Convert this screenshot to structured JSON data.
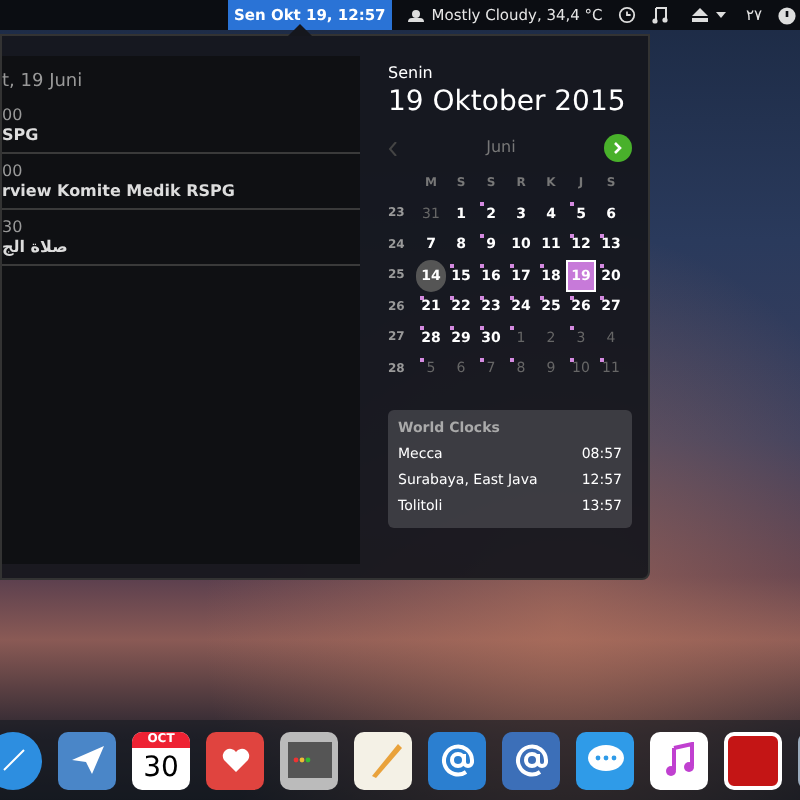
{
  "top_bar": {
    "clock": "Sen Okt 19, 12:57",
    "clock_selected": true,
    "weather": "Mostly Cloudy, 34,4 °C",
    "keyboard_layout": "٢٧"
  },
  "events": {
    "header": "t, 19 Juni",
    "items": [
      {
        "time": "00",
        "title": "SPG"
      },
      {
        "time": "00",
        "title": "rview Komite Medik RSPG"
      },
      {
        "time": "30",
        "title": "صلاة الج"
      }
    ]
  },
  "date": {
    "weekday": "Senin",
    "full": "19 Oktober 2015"
  },
  "calendar": {
    "month": "Juni",
    "day_headers": [
      "M",
      "S",
      "S",
      "R",
      "K",
      "J",
      "S"
    ],
    "weeks": [
      {
        "number": "23",
        "days": [
          {
            "label": "31",
            "muted": true,
            "event": false,
            "selected": false,
            "today": false
          },
          {
            "label": "1",
            "muted": false,
            "event": false,
            "selected": false,
            "today": false
          },
          {
            "label": "2",
            "muted": false,
            "event": true,
            "selected": false,
            "today": false
          },
          {
            "label": "3",
            "muted": false,
            "event": false,
            "selected": false,
            "today": false
          },
          {
            "label": "4",
            "muted": false,
            "event": false,
            "selected": false,
            "today": false
          },
          {
            "label": "5",
            "muted": false,
            "event": true,
            "selected": false,
            "today": false
          },
          {
            "label": "6",
            "muted": false,
            "event": false,
            "selected": false,
            "today": false
          }
        ]
      },
      {
        "number": "24",
        "days": [
          {
            "label": "7",
            "muted": false,
            "event": false,
            "selected": false,
            "today": false
          },
          {
            "label": "8",
            "muted": false,
            "event": false,
            "selected": false,
            "today": false
          },
          {
            "label": "9",
            "muted": false,
            "event": true,
            "selected": false,
            "today": false
          },
          {
            "label": "10",
            "muted": false,
            "event": false,
            "selected": false,
            "today": false
          },
          {
            "label": "11",
            "muted": false,
            "event": false,
            "selected": false,
            "today": false
          },
          {
            "label": "12",
            "muted": false,
            "event": true,
            "selected": false,
            "today": false
          },
          {
            "label": "13",
            "muted": false,
            "event": true,
            "selected": false,
            "today": false
          }
        ]
      },
      {
        "number": "25",
        "days": [
          {
            "label": "14",
            "muted": false,
            "event": false,
            "selected": false,
            "today": true
          },
          {
            "label": "15",
            "muted": false,
            "event": true,
            "selected": false,
            "today": false
          },
          {
            "label": "16",
            "muted": false,
            "event": true,
            "selected": false,
            "today": false
          },
          {
            "label": "17",
            "muted": false,
            "event": true,
            "selected": false,
            "today": false
          },
          {
            "label": "18",
            "muted": false,
            "event": true,
            "selected": false,
            "today": false
          },
          {
            "label": "19",
            "muted": false,
            "event": false,
            "selected": true,
            "today": false
          },
          {
            "label": "20",
            "muted": false,
            "event": true,
            "selected": false,
            "today": false
          }
        ]
      },
      {
        "number": "26",
        "days": [
          {
            "label": "21",
            "muted": false,
            "event": true,
            "selected": false,
            "today": false
          },
          {
            "label": "22",
            "muted": false,
            "event": true,
            "selected": false,
            "today": false
          },
          {
            "label": "23",
            "muted": false,
            "event": true,
            "selected": false,
            "today": false
          },
          {
            "label": "24",
            "muted": false,
            "event": true,
            "selected": false,
            "today": false
          },
          {
            "label": "25",
            "muted": false,
            "event": true,
            "selected": false,
            "today": false
          },
          {
            "label": "26",
            "muted": false,
            "event": true,
            "selected": false,
            "today": false
          },
          {
            "label": "27",
            "muted": false,
            "event": true,
            "selected": false,
            "today": false
          }
        ]
      },
      {
        "number": "27",
        "days": [
          {
            "label": "28",
            "muted": false,
            "event": true,
            "selected": false,
            "today": false
          },
          {
            "label": "29",
            "muted": false,
            "event": true,
            "selected": false,
            "today": false
          },
          {
            "label": "30",
            "muted": false,
            "event": true,
            "selected": false,
            "today": false
          },
          {
            "label": "1",
            "muted": true,
            "event": true,
            "selected": false,
            "today": false
          },
          {
            "label": "2",
            "muted": true,
            "event": false,
            "selected": false,
            "today": false
          },
          {
            "label": "3",
            "muted": true,
            "event": true,
            "selected": false,
            "today": false
          },
          {
            "label": "4",
            "muted": true,
            "event": false,
            "selected": false,
            "today": false
          }
        ]
      },
      {
        "number": "28",
        "days": [
          {
            "label": "5",
            "muted": true,
            "event": true,
            "selected": false,
            "today": false
          },
          {
            "label": "6",
            "muted": true,
            "event": false,
            "selected": false,
            "today": false
          },
          {
            "label": "7",
            "muted": true,
            "event": true,
            "selected": false,
            "today": false
          },
          {
            "label": "8",
            "muted": true,
            "event": true,
            "selected": false,
            "today": false
          },
          {
            "label": "9",
            "muted": true,
            "event": false,
            "selected": false,
            "today": false
          },
          {
            "label": "10",
            "muted": true,
            "event": true,
            "selected": false,
            "today": false
          },
          {
            "label": "11",
            "muted": true,
            "event": true,
            "selected": false,
            "today": false
          }
        ]
      }
    ]
  },
  "world_clocks": {
    "title": "World Clocks",
    "items": [
      {
        "city": "Mecca",
        "time": "08:57"
      },
      {
        "city": "Surabaya, East Java",
        "time": "12:57"
      },
      {
        "city": "Tolitoli",
        "time": "13:57"
      }
    ]
  },
  "dock": {
    "calendar_month": "OCT",
    "calendar_day": "30"
  }
}
